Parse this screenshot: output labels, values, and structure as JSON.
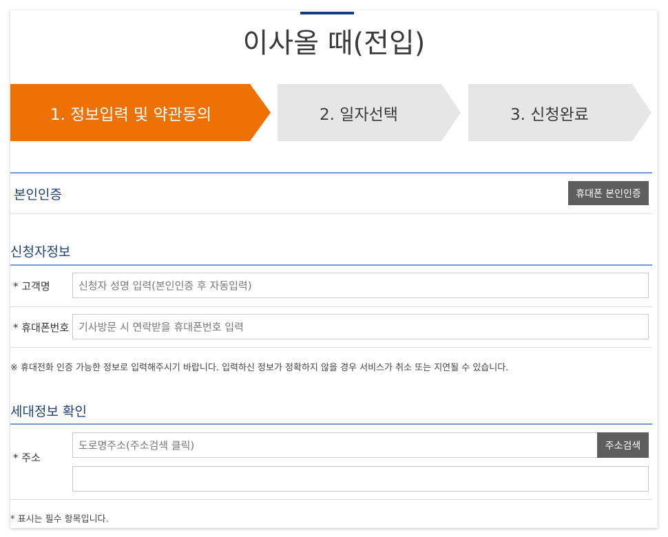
{
  "page": {
    "title": "이사올 때(전입)"
  },
  "steps": [
    {
      "label": "1. 정보입력 및 약관동의",
      "active": true
    },
    {
      "label": "2. 일자선택",
      "active": false
    },
    {
      "label": "3. 신청완료",
      "active": false
    }
  ],
  "auth": {
    "section_label": "본인인증",
    "button_label": "휴대폰 본인인증"
  },
  "applicant": {
    "section_label": "신청자정보",
    "name_label": "* 고객명",
    "name_placeholder": "신청자 성명 입력(본인인증 후 자동입력)",
    "phone_label": "* 휴대폰번호",
    "phone_placeholder": "기사방문 시 연락받을 휴대폰번호 입력",
    "notice": "※ 휴대전화 인증 가능한 정보로 입력해주시기 바랍니다. 입력하신 정보가 정확하지 않을 경우 서비스가 취소 또는 지연될 수 있습니다."
  },
  "household": {
    "section_label": "세대정보 확인",
    "address_label": "* 주소",
    "address_placeholder": "도로명주소(주소검색 클릭)",
    "address_detail_value": "",
    "search_button_label": "주소검색"
  },
  "footer": {
    "required_note": "* 표시는 필수 항목입니다."
  },
  "colors": {
    "accent_orange": "#ee7203",
    "step_inactive": "#e6e6e6",
    "section_blue": "#1d3f7a",
    "divider_blue": "#6f9ad0",
    "button_dark": "#5e5e5e"
  }
}
